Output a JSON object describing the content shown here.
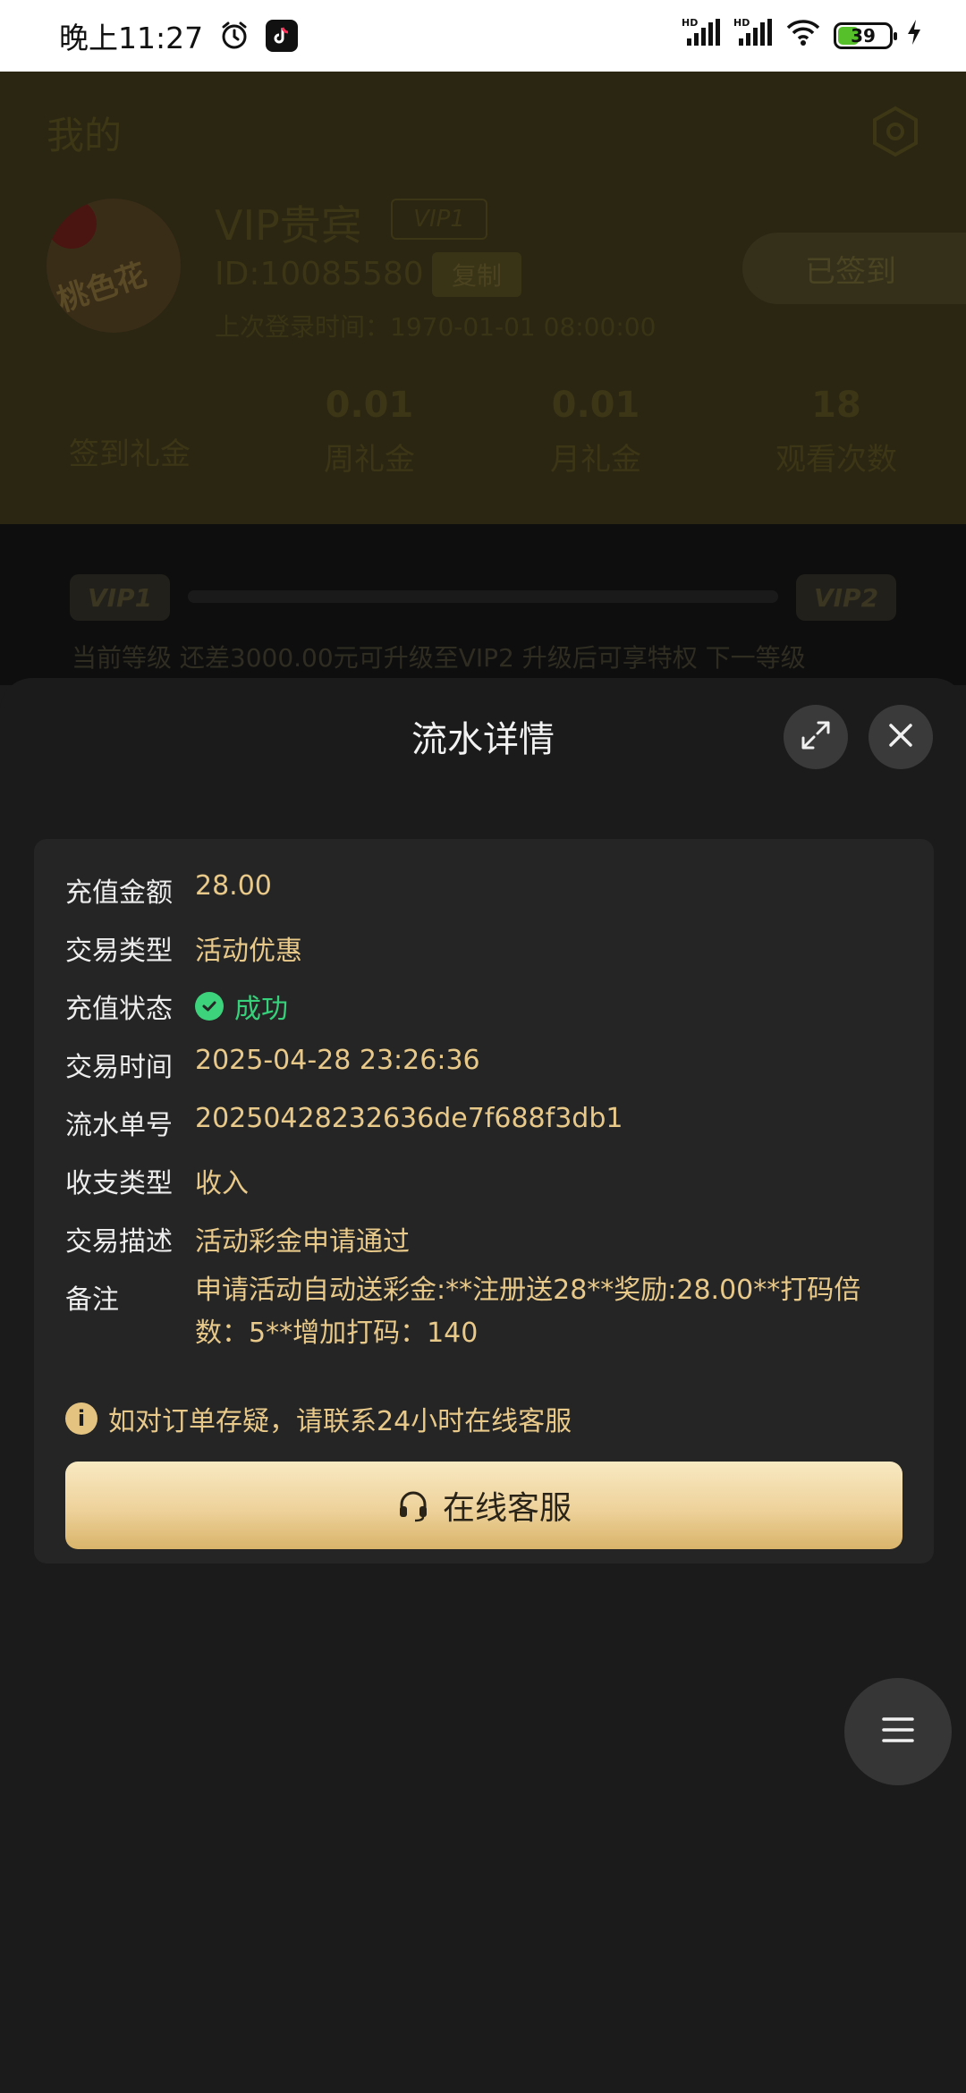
{
  "status_bar": {
    "time": "晚上11:27",
    "battery_level": "39",
    "battery_fraction": 0.39,
    "network_label_1": "HD",
    "network_label_2": "HD"
  },
  "background": {
    "page_title": "我的",
    "avatar_text": "桃色花",
    "user_name": "VIP贵宾",
    "vip_tag": "VIP1",
    "user_id": "ID:10085580",
    "copy_label": "复制",
    "last_login": "上次登录时间：1970-01-01 08:00:00",
    "signed_label": "已签到",
    "stats": [
      {
        "value": "",
        "label": "签到礼金"
      },
      {
        "value": "0.01",
        "label": "周礼金"
      },
      {
        "value": "0.01",
        "label": "月礼金"
      },
      {
        "value": "18",
        "label": "观看次数"
      }
    ],
    "vip_current": "VIP1",
    "vip_next": "VIP2",
    "progress_text": "当前等级   还差3000.00元可升级至VIP2 升级后可享特权   下一等级"
  },
  "sheet": {
    "title": "流水详情",
    "rows": [
      {
        "key": "充值金额",
        "value": "28.00"
      },
      {
        "key": "交易类型",
        "value": "活动优惠"
      },
      {
        "key": "充值状态",
        "value": "成功"
      },
      {
        "key": "交易时间",
        "value": "2025-04-28 23:26:36"
      },
      {
        "key": "流水单号",
        "value": "20250428232636de7f688f3db1"
      },
      {
        "key": "收支类型",
        "value": "收入"
      },
      {
        "key": "交易描述",
        "value": "活动彩金申请通过"
      },
      {
        "key": "备注",
        "value": "申请活动自动送彩金:**注册送28**奖励:28.00**打码倍数：5**增加打码：140"
      }
    ],
    "notice": "如对订单存疑，请联系24小时在线客服",
    "service_button": "在线客服"
  },
  "colors": {
    "accent_gold": "#e8c98a",
    "success_green": "#36d17a",
    "sheet_bg": "#1b1b1b",
    "card_bg": "#252525"
  },
  "icons": [
    "alarm-icon",
    "tiktok-icon",
    "signal-icon",
    "wifi-icon",
    "battery-icon",
    "charging-icon",
    "gear-icon",
    "expand-icon",
    "close-icon",
    "check-circle-icon",
    "info-icon",
    "headset-icon",
    "menu-icon"
  ]
}
